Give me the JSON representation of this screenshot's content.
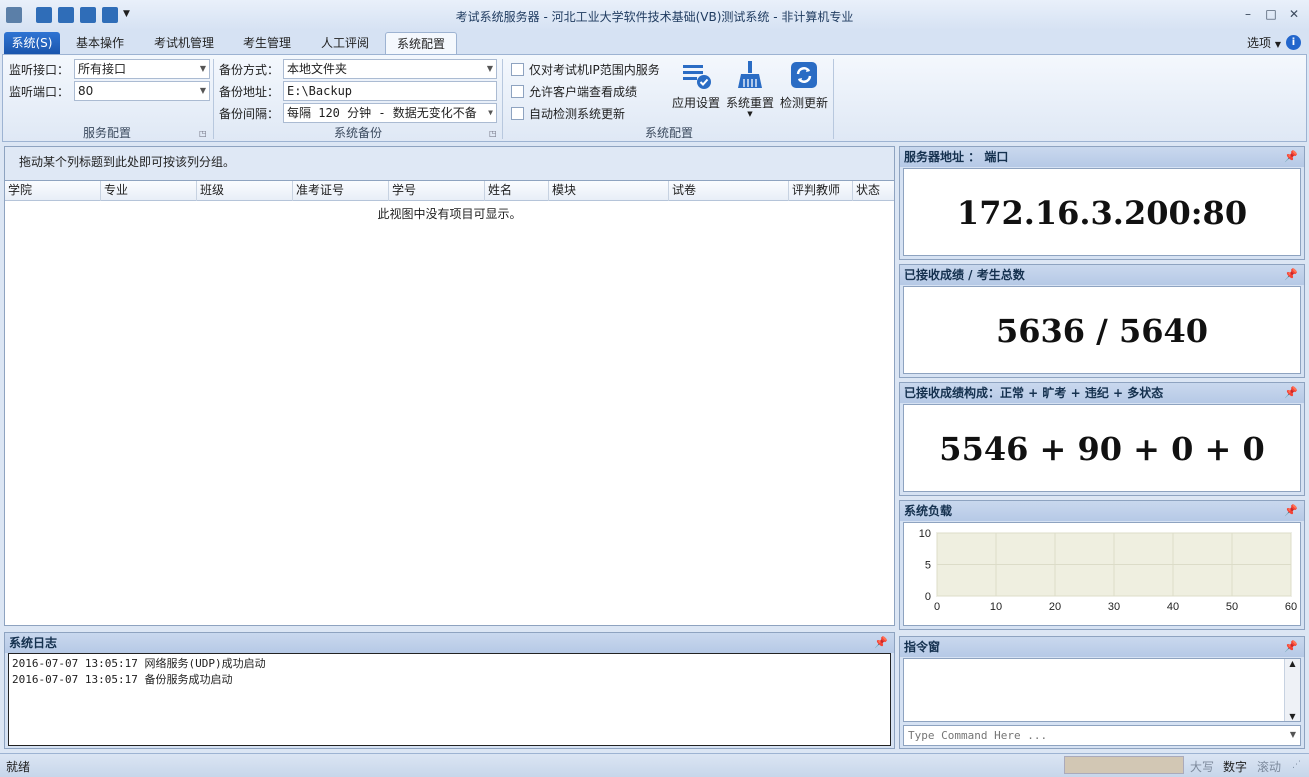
{
  "window": {
    "title": "考试系统服务器 - 河北工业大学软件技术基础(VB)测试系统 - 非计算机专业"
  },
  "ribbon": {
    "tabs": [
      "系统(S)",
      "基本操作",
      "考试机管理",
      "考生管理",
      "人工评阅",
      "系统配置"
    ],
    "options_label": "选项",
    "service": {
      "iface_label": "监听接口：",
      "iface_value": "所有接口",
      "port_label": "监听端口：",
      "port_value": "80",
      "group_label": "服务配置"
    },
    "backup": {
      "mode_label": "备份方式：",
      "mode_value": "本地文件夹",
      "addr_label": "备份地址：",
      "addr_value": "E:\\Backup",
      "interval_label": "备份间隔：",
      "interval_value": "每隔 120 分钟 - 数据无变化不备",
      "group_label": "系统备份"
    },
    "config": {
      "check1": "仅对考试机IP范围内服务",
      "check2": "允许客户端查看成绩",
      "check3": "自动检测系统更新",
      "btn_apply": "应用设置",
      "btn_reset": "系统重置",
      "btn_update": "检测更新",
      "group_label": "系统配置"
    }
  },
  "grid": {
    "group_hint": "拖动某个列标题到此处即可按该列分组。",
    "columns": [
      "学院",
      "专业",
      "班级",
      "准考证号",
      "学号",
      "姓名",
      "模块",
      "试卷",
      "评判教师",
      "状态"
    ],
    "empty_text": "此视图中没有项目可显示。"
  },
  "log": {
    "title": "系统日志",
    "lines": [
      "2016-07-07 13:05:17 网络服务(UDP)成功启动",
      "2016-07-07 13:05:17 备份服务成功启动"
    ]
  },
  "panels": {
    "server": {
      "title": "服务器地址 ： 端口",
      "value": "172.16.3.200:80"
    },
    "received": {
      "title": "已接收成绩 / 考生总数",
      "value": "5636 / 5640"
    },
    "composition": {
      "title": "已接收成绩构成：正常 + 旷考 + 违纪 + 多状态",
      "value": "5546 + 90 + 0 + 0"
    },
    "load": {
      "title": "系统负载"
    },
    "command": {
      "title": "指令窗",
      "placeholder": "Type Command Here ..."
    }
  },
  "chart_data": {
    "type": "line",
    "x_ticks": [
      "0",
      "10",
      "20",
      "30",
      "40",
      "50",
      "60"
    ],
    "y_ticks": [
      "0",
      "5",
      "10"
    ],
    "xlim": [
      0,
      60
    ],
    "ylim": [
      0,
      10
    ],
    "series": []
  },
  "statusbar": {
    "status": "就绪",
    "caps": "大写",
    "num": "数字",
    "scroll": "滚动"
  }
}
